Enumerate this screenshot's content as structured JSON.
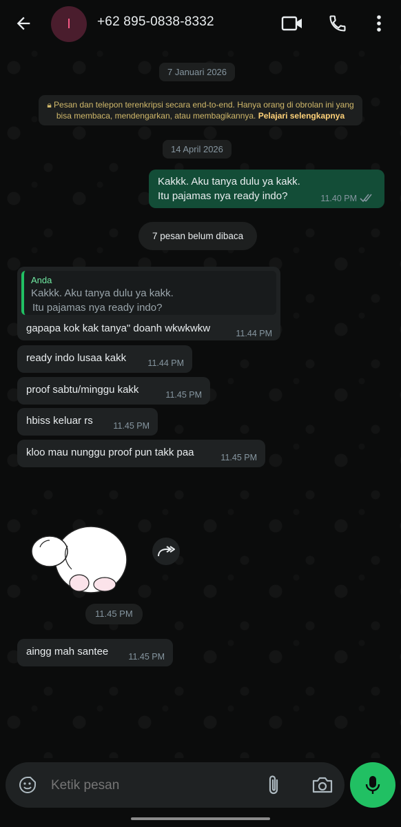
{
  "header": {
    "avatar_letter": "I",
    "title": "+62 895-0838-8332",
    "icons": [
      "back-arrow-icon",
      "video-call-icon",
      "phone-icon",
      "more-vert-icon"
    ]
  },
  "chat": {
    "date_1": "7 Januari 2026",
    "encryption_text": "Pesan dan telepon terenkripsi secara end-to-end. Hanya orang di obrolan ini yang bisa membaca, mendengarkan, atau membagikannya.",
    "encryption_link": "Pelajari selengkapnya",
    "date_2": "14 April 2026",
    "outgoing": {
      "line1": "Kakkk. Aku tanya dulu ya kakk.",
      "line2": "Itu pajamas nya ready indo?",
      "time": "11.40 PM"
    },
    "unread_label": "7 pesan belum dibaca",
    "reply": {
      "quote_author": "Anda",
      "quote_line1": "Kakkk. Aku tanya dulu ya kakk.",
      "quote_line2": "Itu pajamas nya ready indo?",
      "text": "gapapa kok kak tanya\" doanh wkwkwkw",
      "time": "11.44 PM"
    },
    "messages": [
      {
        "text": "ready indo lusaa kakk",
        "time": "11.44 PM"
      },
      {
        "text": "proof sabtu/minggu kakk",
        "time": "11.45 PM"
      },
      {
        "text": "hbiss keluar rs",
        "time": "11.45 PM"
      },
      {
        "text": "kloo mau nunggu proof pun takk paa",
        "time": "11.45 PM"
      }
    ],
    "sticker_time": "11.45 PM",
    "last_message": {
      "text": "aingg mah santee",
      "time": "11.45 PM"
    }
  },
  "input": {
    "placeholder": "Ketik pesan",
    "icons": [
      "sticker-icon",
      "attach-icon",
      "camera-icon",
      "mic-icon"
    ]
  }
}
